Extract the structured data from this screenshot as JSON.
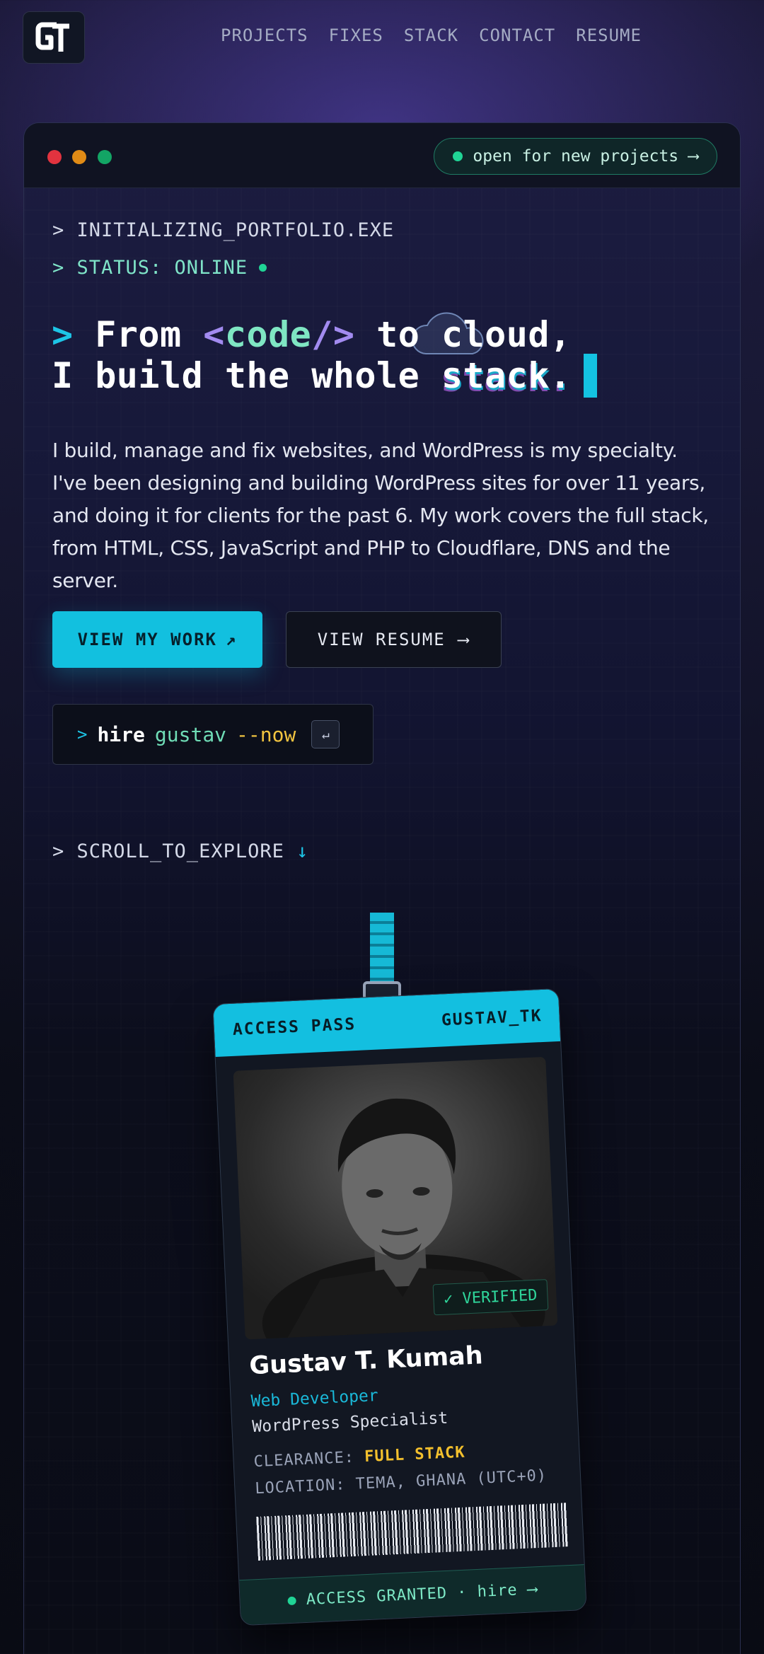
{
  "nav": {
    "logo_alt": "GT",
    "items": [
      "PROJECTS",
      "FIXES",
      "STACK",
      "CONTACT",
      "RESUME"
    ]
  },
  "window": {
    "status_pill": "open for new projects",
    "status_arrow": "⟶",
    "terminal_line_1": "> INITIALIZING_PORTFOLIO.EXE",
    "terminal_line_2": "> STATUS: ONLINE"
  },
  "headline": {
    "prompt": ">",
    "from": "From",
    "code_open": "<",
    "code_word": "code",
    "code_close": "/>",
    "to": "to",
    "cloud": "cloud,",
    "line2_a": "I build the whole",
    "line2_b": "stack."
  },
  "bio": "I build, manage and fix websites, and WordPress is my specialty. I've been designing and building WordPress sites for over 11 years, and doing it for clients for the past 6. My work covers the full stack, from HTML, CSS, JavaScript and PHP to Cloudflare, DNS and the server.",
  "buttons": {
    "primary": "VIEW MY WORK",
    "primary_icon": "↗",
    "secondary": "VIEW RESUME",
    "secondary_icon": "⟶"
  },
  "hire": {
    "prompt": ">",
    "cmd": "hire",
    "arg": "gustav",
    "flag": "--now",
    "enter": "↵"
  },
  "scroll": {
    "label": "> SCROLL_TO_EXPLORE",
    "arrow": "↓"
  },
  "badge": {
    "title": "ACCESS PASS",
    "handle": "GUSTAV_TK",
    "verified": "✓ VERIFIED",
    "name": "Gustav T. Kumah",
    "role": "Web Developer",
    "specialty": "WordPress Specialist",
    "clearance_label": "CLEARANCE:",
    "clearance_value": "FULL STACK",
    "location": "LOCATION: TEMA, GHANA (UTC+0)",
    "footer": "ACCESS GRANTED · hire ⟶"
  },
  "colors": {
    "accent": "#12c0df",
    "green": "#20d495",
    "yellow": "#f2c440",
    "purple": "#a28bf0"
  }
}
